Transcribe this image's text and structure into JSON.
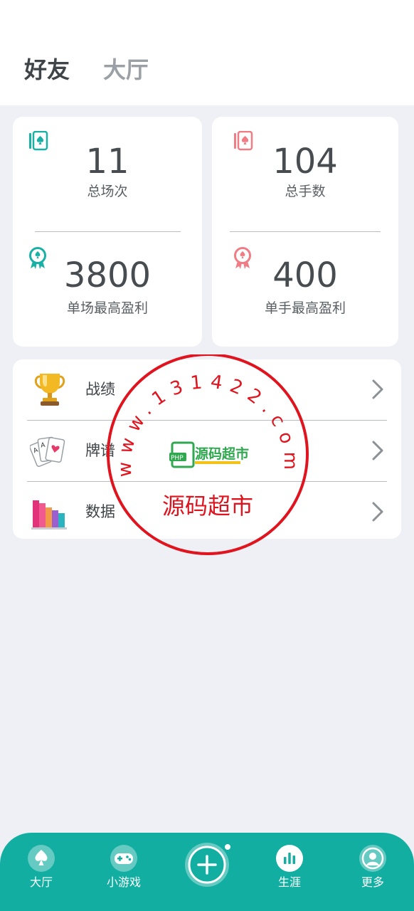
{
  "header": {
    "tabs": [
      {
        "label": "好友",
        "active": true
      },
      {
        "label": "大厅",
        "active": false
      }
    ]
  },
  "stats": {
    "left_top": {
      "value": "11",
      "label": "总场次",
      "icon": "spade-card-icon",
      "color": "#19b0a6"
    },
    "left_bottom": {
      "value": "3800",
      "label": "单场最高盈利",
      "icon": "spade-medal-icon",
      "color": "#19b0a6"
    },
    "right_top": {
      "value": "104",
      "label": "总手数",
      "icon": "spade-card-icon",
      "color": "#f07c86"
    },
    "right_bottom": {
      "value": "400",
      "label": "单手最高盈利",
      "icon": "spade-medal-icon",
      "color": "#f07c86"
    }
  },
  "menu": {
    "items": [
      {
        "label": "战绩",
        "icon": "trophy-icon"
      },
      {
        "label": "牌谱",
        "icon": "playing-cards-icon"
      },
      {
        "label": "数据",
        "icon": "bar-chart-icon"
      }
    ]
  },
  "watermark": {
    "ring_text": "www.131422.com",
    "center_text": "源码超市",
    "logo_text": "源码超市",
    "logo_badge": "PHP",
    "color": "#e0141e"
  },
  "tabbar": {
    "items": [
      {
        "label": "大厅",
        "icon": "spade-icon"
      },
      {
        "label": "小游戏",
        "icon": "gamepad-icon"
      },
      {
        "label": "生涯",
        "icon": "bar-chart-icon"
      },
      {
        "label": "更多",
        "icon": "user-icon"
      }
    ],
    "accent": "#12aea1"
  }
}
